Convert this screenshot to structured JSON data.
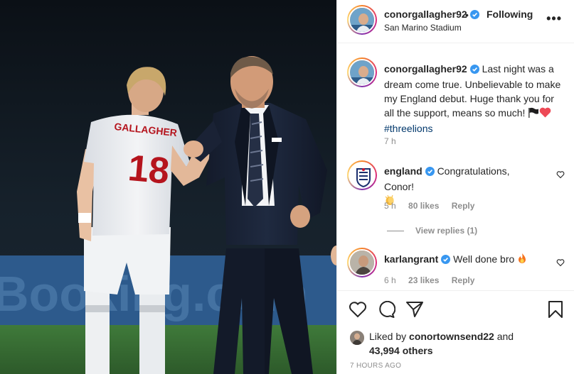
{
  "header": {
    "username": "conorgallagher92",
    "separator": "•",
    "follow_label": "Following",
    "location": "San Marino Stadium",
    "more_label": "•••"
  },
  "photo": {
    "jersey_name": "GALLAGHER",
    "jersey_number": "18",
    "banner_text": "Booking.com"
  },
  "caption": {
    "username": "conorgallagher92",
    "text": "Last night was a dream come true. Unbelievable to make my England debut. Huge thank you for all the support, means so much!",
    "hashtag": "#threelions",
    "time": "7 h"
  },
  "comments": [
    {
      "username": "england",
      "text": "Congratulations, Conor!",
      "time": "5 h",
      "likes": "80 likes",
      "reply": "Reply",
      "view_replies": "View replies (1)"
    },
    {
      "username": "karlangrant",
      "text": "Well done bro",
      "time": "6 h",
      "likes": "23 likes",
      "reply": "Reply"
    }
  ],
  "likes": {
    "prefix": "Liked by",
    "user": "conortownsend22",
    "middle": "and",
    "others": "43,994 others"
  },
  "timestamp": "7 HOURS AGO",
  "colors": {
    "verified": "#3897f0",
    "link": "#00376b",
    "muted": "#8e8e8e",
    "heart": "#ed4956"
  },
  "icons": [
    "heart-icon",
    "comment-icon",
    "share-icon",
    "bookmark-icon",
    "verified-icon",
    "more-icon"
  ]
}
